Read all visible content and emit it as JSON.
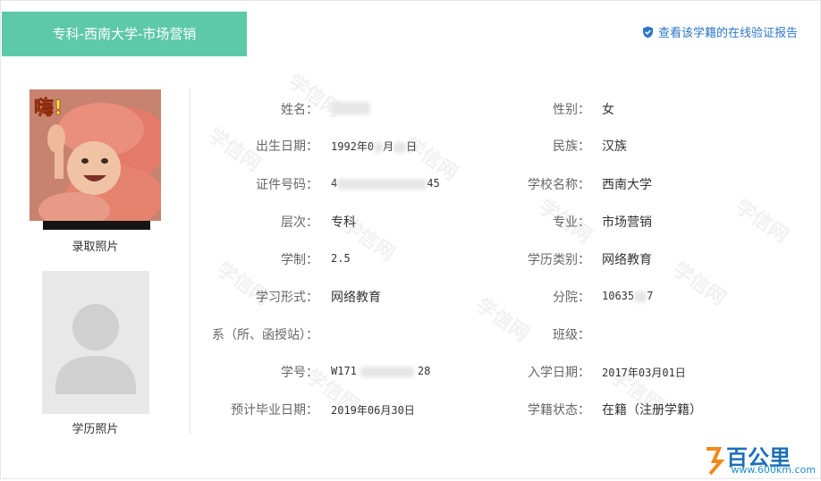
{
  "header": {
    "tab_title": "专科-西南大学-市场营销",
    "verify_link": "查看该学籍的在线验证报告"
  },
  "photos": {
    "admission_badge": "嗨!",
    "admission_label": "录取照片",
    "diploma_label": "学历照片"
  },
  "fields": {
    "name_label": "姓名：",
    "name_value": "",
    "gender_label": "性别：",
    "gender_value": "女",
    "birth_label": "出生日期：",
    "birth_value_pre": "1992年0",
    "birth_value_mid": "月",
    "birth_value_post": "日",
    "ethnicity_label": "民族：",
    "ethnicity_value": "汉族",
    "id_label": "证件号码：",
    "id_value_pre": "4",
    "id_value_post": "45",
    "school_label": "学校名称：",
    "school_value": "西南大学",
    "level_label": "层次：",
    "level_value": "专科",
    "major_label": "专业：",
    "major_value": "市场营销",
    "duration_label": "学制：",
    "duration_value": "2.5",
    "edu_type_label": "学历类别：",
    "edu_type_value": "网络教育",
    "study_form_label": "学习形式：",
    "study_form_value": "网络教育",
    "branch_label": "分院：",
    "branch_value_pre": "10635",
    "branch_value_post": "7",
    "dept_label": "系（所、函授站）：",
    "dept_value": "",
    "class_label": "班级：",
    "class_value": "",
    "student_no_label": "学号：",
    "student_no_pre": "W171",
    "student_no_post": "28",
    "enroll_label": "入学日期：",
    "enroll_value": "2017年03月01日",
    "graduate_label": "预计毕业日期：",
    "graduate_value": "2019年06月30日",
    "status_label": "学籍状态：",
    "status_value": "在籍（注册学籍）"
  },
  "watermark_text": "学信网",
  "footer_logo": {
    "text": "百公里",
    "url": "www.600km.com"
  },
  "colors": {
    "tab_bg": "#5ec9a7",
    "link": "#2c76c7",
    "label": "#666666",
    "value": "#333333"
  }
}
